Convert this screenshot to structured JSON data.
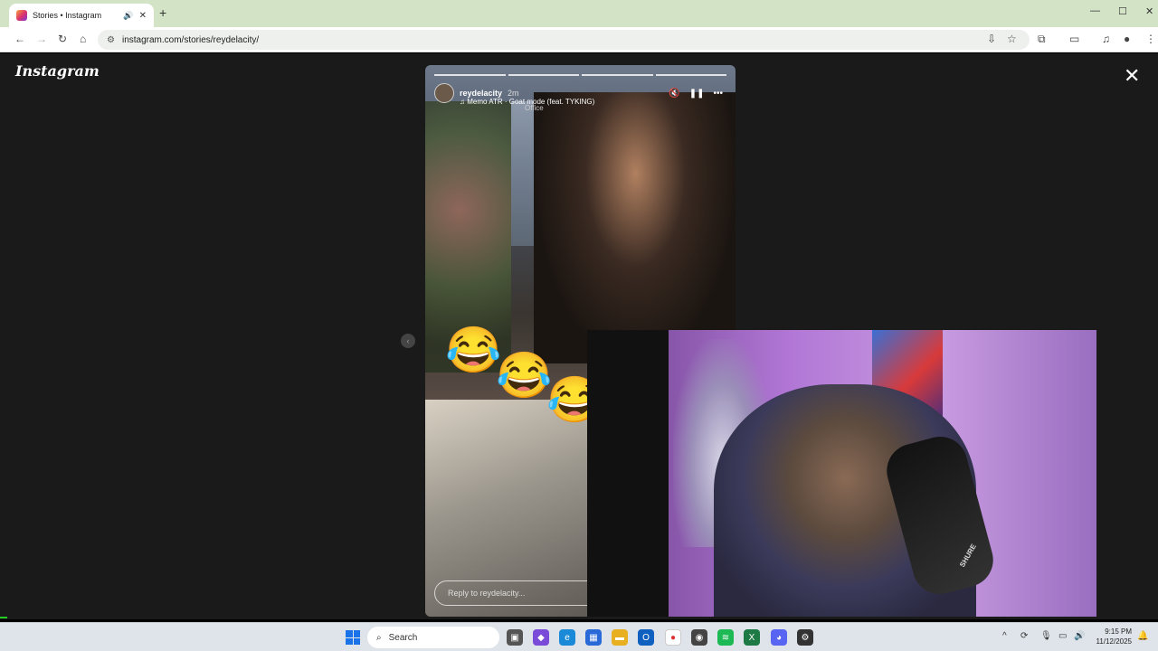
{
  "browser": {
    "tab_title": "Stories • Instagram",
    "url": "instagram.com/stories/reydelacity/"
  },
  "page": {
    "logo": "Instagram"
  },
  "story": {
    "username": "reydelacity",
    "time": "2m",
    "song": "Memo ATR · Goat mode (feat. TYKING)",
    "location_tag": "Office",
    "reply_placeholder": "Reply to reydelacity...",
    "emoji": "😂"
  },
  "webcam": {
    "mic_brand": "SHURE"
  },
  "taskbar": {
    "search_label": "Search",
    "time": "9:15 PM",
    "date": "11/12/2025"
  }
}
